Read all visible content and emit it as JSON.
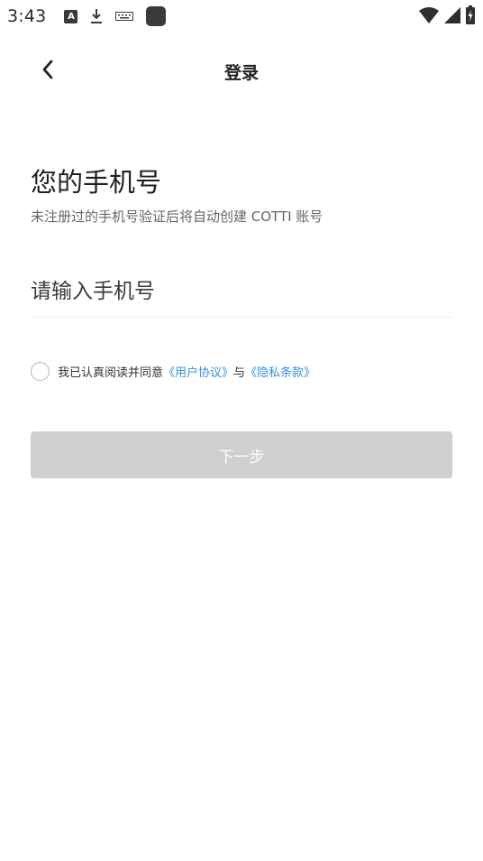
{
  "status_bar": {
    "time": "3:43",
    "left_icons": [
      "a-notification-icon",
      "download-icon",
      "keyboard-icon",
      "app-square-icon"
    ],
    "right_icons": [
      "wifi-icon",
      "signal-icon",
      "battery-charging-icon"
    ],
    "a_icon_letter": "A"
  },
  "nav": {
    "title": "登录",
    "back_icon": "chevron-left-icon"
  },
  "main": {
    "heading": "您的手机号",
    "subheading": "未注册过的手机号验证后将自动创建 COTTI 账号",
    "phone_input": {
      "value": "",
      "placeholder": "请输入手机号"
    },
    "agreement": {
      "prefix": "我已认真阅读并同意",
      "user_agreement": "《用户协议》",
      "connector": "与",
      "privacy_policy": "《隐私条款》",
      "checked": false
    },
    "next_button_label": "下一步"
  },
  "colors": {
    "link": "#3a8ee6",
    "button_disabled": "#cfcfcf",
    "subtext": "#666666"
  }
}
